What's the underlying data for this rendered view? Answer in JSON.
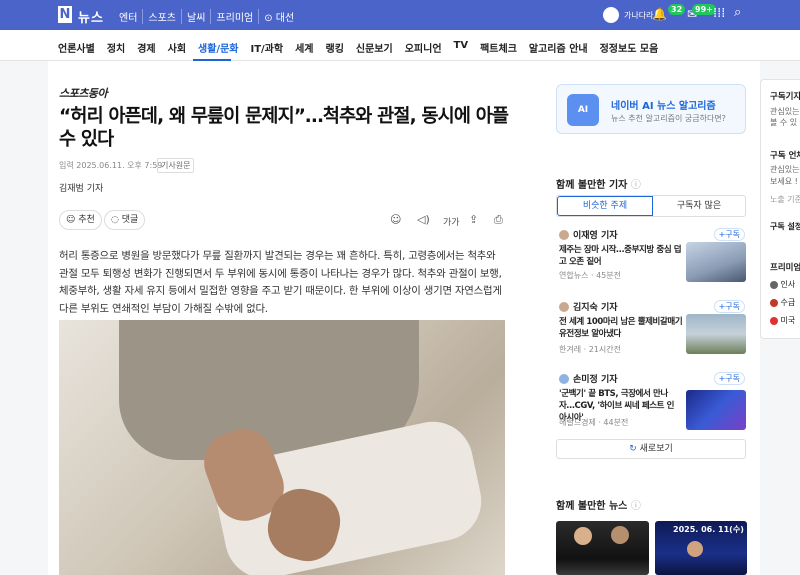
{
  "topbar": {
    "logo": "N",
    "brand": "뉴스",
    "nav": [
      "엔터",
      "스포츠",
      "날씨",
      "프리미엄",
      "대선"
    ],
    "username": "가나다라",
    "mail_count": "32",
    "notif_count": "99+"
  },
  "categories": [
    "언론사별",
    "정치",
    "경제",
    "사회",
    "생활/문화",
    "IT/과학",
    "세계",
    "랭킹",
    "신문보기",
    "오피니언",
    "TV",
    "팩트체크",
    "알고리즘 안내",
    "정정보도 모음"
  ],
  "article": {
    "press": "스포츠동아",
    "title": "“허리 아픈데, 왜 무릎이 문제지”…척추와 관절, 동시에 아플 수 있다",
    "date": "입력 2025.06.11. 오후 7:59",
    "original": "기사원문",
    "author": "김재범 기자",
    "recommend": "추천",
    "comment": "댓글",
    "text_size": "가가",
    "body": "허리 통증으로 병원을 방문했다가 무릎 질환까지 발견되는 경우는 꽤 흔하다. 특히, 고령층에서는 척추와 관절 모두 퇴행성 변화가 진행되면서 두 부위에 동시에 통증이 나타나는 경우가 많다. 척추와 관절이 보행, 체중부하, 생활 자세 유지 등에서 밀접한 영향을 주고 받기 때문이다. 한 부위에 이상이 생기면 자연스럽게 다른 부위도 연쇄적인 부담이 가해질 수밖에 없다."
  },
  "sidebar": {
    "ai_title": "네이버 AI 뉴스 알고리즘",
    "ai_sub": "뉴스 추천 알고리즘이 궁금하다면?",
    "ai_icon": "AI",
    "section1": "함께 볼만한 기자",
    "seg_on": "비슷한 주제",
    "seg_off": "구독자 많은",
    "subscribe": "+구독",
    "reporters": [
      {
        "name": "이재영 기자",
        "headline": "제주는 장마 시작…중부지방 중심 덥고 오존 짙어",
        "meta": "연합뉴스 · 45분전"
      },
      {
        "name": "김지숙 기자",
        "headline": "전 세계 100마리 남은 뿔제비갈매기 유전정보 알아냈다",
        "meta": "한겨레 · 21시간전"
      },
      {
        "name": "손미정 기자",
        "headline": "'군백기' 끝 BTS, 극장에서 만나자…CGV, '하이브 씨네 페스트 인 아시아'",
        "meta": "헤럴드경제 · 44분전"
      }
    ],
    "more": "새로보기",
    "section2": "함께 볼만한 뉴스",
    "news_date": "2025. 06. 11(수)"
  },
  "right_panel": {
    "t1": "구독기자",
    "d1a": "관심있는",
    "d1b": "볼 수 있",
    "t2": "구독 언채",
    "d2a": "관심있는",
    "d2b": "보세요 !",
    "d2c": "노출 기준 &",
    "t3": "구독 설정",
    "t4": "프리미엄",
    "p1": "인사",
    "p2": "수급",
    "p3": "미국"
  },
  "colors": {
    "brand": "#4b64c9",
    "accent": "#1d66d8",
    "badge": "#22c55e"
  }
}
